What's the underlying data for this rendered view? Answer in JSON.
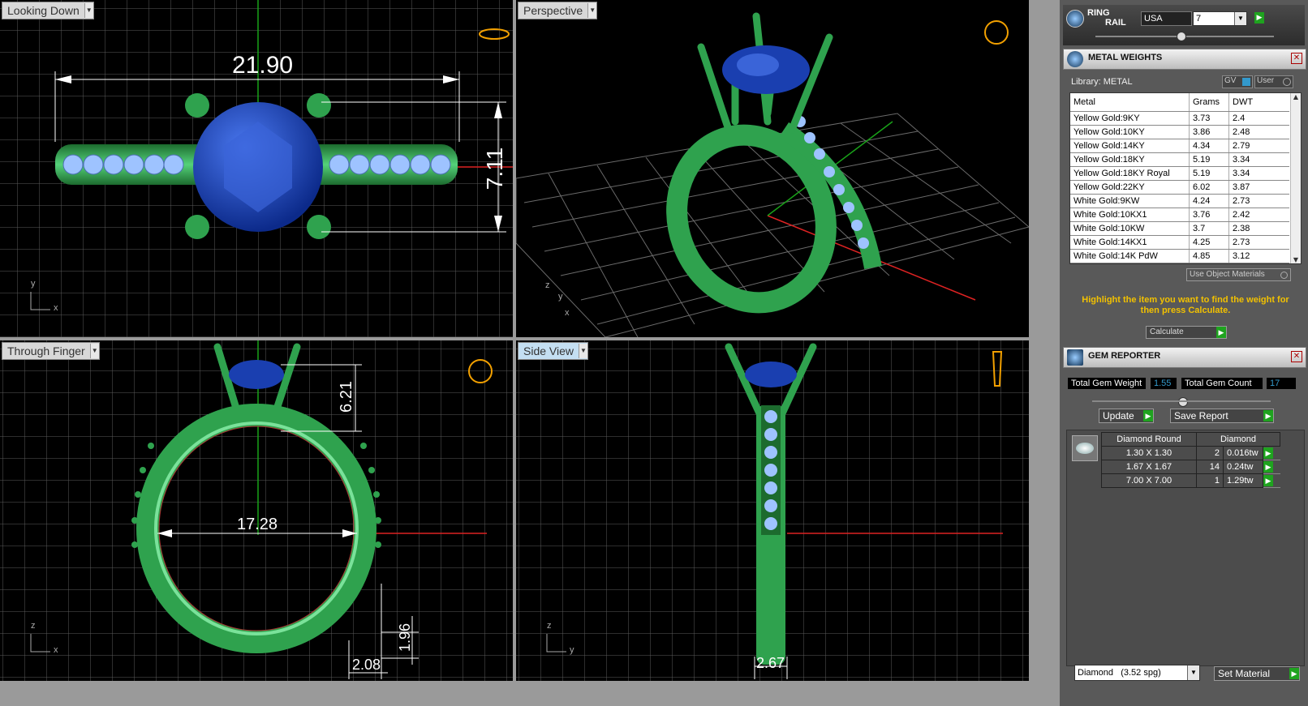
{
  "viewports": {
    "top": {
      "label": "Looking Down",
      "dim_width": "21.90",
      "dim_height": "7.11",
      "axis_y": "y",
      "axis_x": "x"
    },
    "persp": {
      "label": "Perspective",
      "axis_z": "z",
      "axis_y": "y",
      "axis_x": "x"
    },
    "front": {
      "label": "Through Finger",
      "dim_inner": "17.28",
      "dim_head": "6.21",
      "dim_shank": "1.96",
      "dim_bottom": "2.08",
      "axis_z": "z",
      "axis_x": "x"
    },
    "side": {
      "label": "Side View",
      "dim_width": "2.67",
      "axis_z": "z",
      "axis_y": "y"
    }
  },
  "ring_rail": {
    "title1": "RING",
    "title2": "RAIL",
    "country": "USA",
    "size": "7"
  },
  "metal_weights": {
    "title": "METAL WEIGHTS",
    "library": "Library: METAL",
    "gv": "GV",
    "user": "User",
    "columns": [
      "Metal",
      "Grams",
      "DWT"
    ],
    "rows": [
      {
        "metal": "Yellow Gold:9KY",
        "grams": "3.73",
        "dwt": "2.4"
      },
      {
        "metal": "Yellow Gold:10KY",
        "grams": "3.86",
        "dwt": "2.48"
      },
      {
        "metal": "Yellow Gold:14KY",
        "grams": "4.34",
        "dwt": "2.79"
      },
      {
        "metal": "Yellow Gold:18KY",
        "grams": "5.19",
        "dwt": "3.34"
      },
      {
        "metal": "Yellow Gold:18KY Royal",
        "grams": "5.19",
        "dwt": "3.34"
      },
      {
        "metal": "Yellow Gold:22KY",
        "grams": "6.02",
        "dwt": "3.87"
      },
      {
        "metal": "White Gold:9KW",
        "grams": "4.24",
        "dwt": "2.73"
      },
      {
        "metal": "White Gold:10KX1",
        "grams": "3.76",
        "dwt": "2.42"
      },
      {
        "metal": "White Gold:10KW",
        "grams": "3.7",
        "dwt": "2.38"
      },
      {
        "metal": "White Gold:14KX1",
        "grams": "4.25",
        "dwt": "2.73"
      },
      {
        "metal": "White Gold:14K PdW",
        "grams": "4.85",
        "dwt": "3.12"
      }
    ],
    "use_object": "Use Object Materials",
    "hint": "Highlight the item you want to find the weight for then press Calculate.",
    "calculate": "Calculate"
  },
  "gem_reporter": {
    "title": "GEM REPORTER",
    "total_weight_label": "Total Gem Weight",
    "total_weight": "1.55",
    "total_count_label": "Total Gem Count",
    "total_count": "17",
    "update": "Update",
    "save_report": "Save Report",
    "head_shape": "Diamond Round",
    "head_type": "Diamond",
    "rows": [
      {
        "size": "1.30 X 1.30",
        "count": "2",
        "weight": "0.016tw"
      },
      {
        "size": "1.67 X 1.67",
        "count": "14",
        "weight": "0.24tw"
      },
      {
        "size": "7.00 X 7.00",
        "count": "1",
        "weight": "1.29tw"
      }
    ],
    "material": "Diamond",
    "material_sg": "(3.52 spg)",
    "set_material": "Set Material"
  },
  "colors": {
    "ring": "#2fa24e",
    "gem": "#1a3fb0",
    "melee": "#9ec3ff",
    "grid": "#5a5a5a",
    "accent": "#f2c100"
  }
}
